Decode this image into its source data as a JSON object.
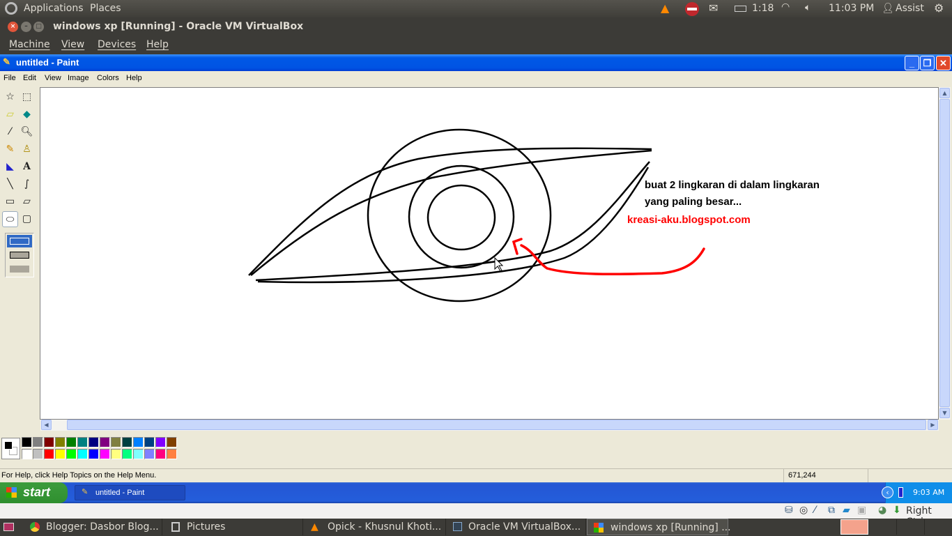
{
  "top_panel": {
    "applications": "Applications",
    "places": "Places",
    "battery_time": "1:18",
    "clock": "11:03 PM",
    "user": "Assist",
    "icons": [
      "ubuntu-logo-icon",
      "vlc-icon",
      "stop-icon",
      "mail-icon",
      "battery-icon",
      "wifi-icon",
      "volume-icon",
      "user-icon",
      "power-icon"
    ]
  },
  "vbox": {
    "title": "windows xp [Running] - Oracle VM VirtualBox",
    "menu": [
      "Machine",
      "View",
      "Devices",
      "Help"
    ],
    "host_key": "Right Ctrl"
  },
  "paint": {
    "title": "untitled - Paint",
    "menu": [
      "File",
      "Edit",
      "View",
      "Image",
      "Colors",
      "Help"
    ],
    "tools": [
      "free-select",
      "rect-select",
      "eraser",
      "fill",
      "color-picker",
      "magnifier",
      "pencil",
      "brush",
      "airbrush",
      "text",
      "line",
      "curve",
      "rectangle",
      "polygon",
      "ellipse",
      "rounded-rectangle"
    ],
    "selected_tool": "ellipse",
    "canvas_text": {
      "line1": "buat 2 lingkaran di dalam lingkaran",
      "line2": "yang paling besar...",
      "watermark": "kreasi-aku.blogspot.com"
    },
    "colors": {
      "foreground": "#000000",
      "background": "#ffffff",
      "row1": [
        "#000000",
        "#808080",
        "#800000",
        "#808000",
        "#008000",
        "#008080",
        "#000080",
        "#800080",
        "#808040",
        "#004040",
        "#0080ff",
        "#004080",
        "#8000ff",
        "#804000"
      ],
      "row2": [
        "#ffffff",
        "#c0c0c0",
        "#ff0000",
        "#ffff00",
        "#00ff00",
        "#00ffff",
        "#0000ff",
        "#ff00ff",
        "#ffff80",
        "#00ff80",
        "#80ffff",
        "#8080ff",
        "#ff0080",
        "#ff8040"
      ],
      "annotation": "#ff0000"
    },
    "status_help": "For Help, click Help Topics on the Help Menu.",
    "coords": "671,244"
  },
  "xp_taskbar": {
    "start": "start",
    "task": "untitled - Paint",
    "clock": "9:03 AM"
  },
  "bottom_panel": {
    "tasks": [
      "Blogger: Dasbor Blog...",
      "Pictures",
      "Opick - Khusnul Khoti...",
      "Oracle VM VirtualBox...",
      "windows xp [Running] ..."
    ]
  }
}
